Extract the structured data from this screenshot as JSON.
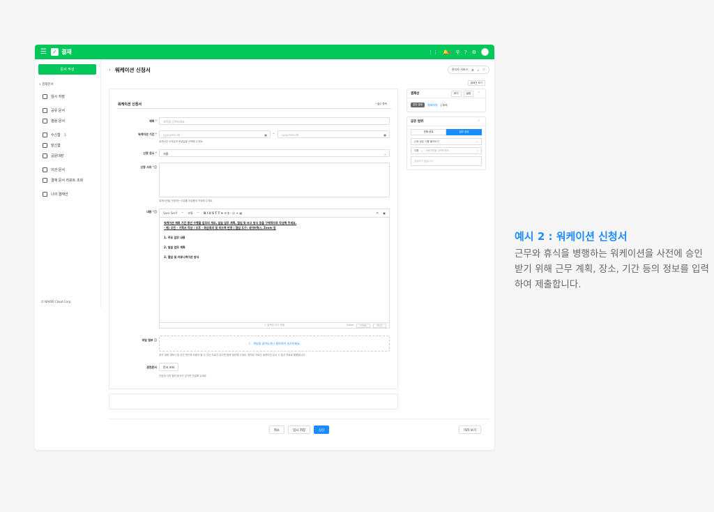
{
  "topbar": {
    "app_title": "결재"
  },
  "sidebar": {
    "write_button": "문서 작성",
    "section": "• 결재문서",
    "items": [
      {
        "label": "임시 저장",
        "count": ""
      },
      {
        "label": "공유 문서",
        "count": ""
      },
      {
        "label": "열람 문서",
        "count": ""
      },
      {
        "label": "수신함",
        "count": "1"
      },
      {
        "label": "발신함",
        "count": ""
      },
      {
        "label": "공문대장",
        "count": ""
      },
      {
        "label": "이관 문서",
        "count": ""
      },
      {
        "label": "결재 문서 리포트 조회",
        "count": ""
      },
      {
        "label": "나의 결재선",
        "count": ""
      }
    ],
    "footer": "© NAVER Cloud Corp."
  },
  "header": {
    "back": "‹",
    "title": "워케이션 신청서",
    "pill_label": "관리자 서비스",
    "preview_label": "결재선 보기"
  },
  "form": {
    "title": "워케이션 신청서",
    "required_note": "* 필수 항목",
    "subject_label": "제목",
    "subject_placeholder": "제목을 입력하세요.",
    "period_label": "워케이션 기간",
    "date_placeholder": "yyyy.mm.dd",
    "period_help": "워케이션 시작일과 종료일을 선택해 주세요.",
    "place_label": "신청 장소",
    "place_value": "서울",
    "reason_label": "신청 사유",
    "reason_help": "워케이션을 신청하는 이유를 자유롭게 작성해 주세요.",
    "content_label": "내용",
    "toolbar_font": "Sans Serif",
    "toolbar_size": "보통",
    "toolbar_symbols": "B  I  U  S  T  T   ≡  ☰  ⌶  ∙  ☺  ⚭  ▦",
    "editor_lines": [
      "워케이션 체류 기간 동안 수행할 업무의 개요, 일일 업무 계획, 협업 및 보고 방식 등을 구체적으로 작성해 주세요.",
      "- 예: 오전 - 기획서 작성 / 오후 - 화상회의 및 피드백 반영 | 협업 도구: 네이버웍스, Zoom 등"
    ],
    "editor_sections": [
      "1. 주요 업무 내용",
      "2. 일일 업무 계획",
      "3. 협업 및 커뮤니케이션 방식"
    ],
    "editor_footer": "+ 입력칸 크기 조절",
    "editor_modes": [
      "Editor",
      "HTML",
      "TEXT"
    ],
    "attach_label": "파일 첨부",
    "attach_text": "파일을 끌어오거나 클릭하여 추가하세요.",
    "attach_help": "참석 계획 계획서 등 승인 판단에 도움이 될 수 있는 자료가 있다면 함께 첨부해 주세요. 첨부된 자료는 워케이션 심사 시 참고 자료로 활용됩니다.",
    "related_label": "관련문서",
    "related_button": "문서 조회",
    "related_help": "관련된 사전 협의 문서가 있다면 연결해 주세요."
  },
  "approval": {
    "title": "결재선",
    "view": "보기",
    "settings": "설정",
    "tag": "일반 결재",
    "approver": "결재자명",
    "dept": "부서"
  },
  "share": {
    "title": "공유 범위",
    "tab_all": "전체 공유",
    "tab_some": "일부 공유",
    "group_select": "나의 공유 그룹 불러오기",
    "search_scope": "이름",
    "search_placeholder": "사용자명을 입력하세요.",
    "empty": "공유자가 없습니다."
  },
  "actions": {
    "cancel": "취소",
    "save_draft": "임시 저장",
    "submit": "상신",
    "preview": "미리 보기"
  },
  "caption": {
    "title": "예시 2 : 워케이션 신청서",
    "desc": "근무와 휴식을 병행하는 워케이션을 사전에 승인받기 위해 근무 계획, 장소, 기간 등의 정보를 입력하여 제출합니다."
  },
  "colors": {
    "brand": "#03c75a",
    "accent": "#1a8cff"
  }
}
